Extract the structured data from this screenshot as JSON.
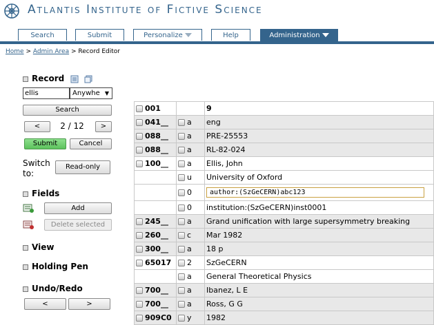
{
  "header": {
    "site_title": "Atlantis Institute of Fictive Science",
    "tabs": [
      {
        "label": "Search"
      },
      {
        "label": "Submit"
      },
      {
        "label": "Personalize"
      },
      {
        "label": "Help"
      },
      {
        "label": "Administration"
      }
    ]
  },
  "breadcrumb": {
    "home": "Home",
    "sep1": " > ",
    "admin": "Admin Area",
    "sep2": " > ",
    "current": "Record Editor"
  },
  "sidebar": {
    "record_title": "Record",
    "search_value": "ellis",
    "search_scope": "Anywhe",
    "search_button": "Search",
    "prev_label": "<",
    "next_label": ">",
    "position": "2 / 12",
    "submit_label": "Submit",
    "cancel_label": "Cancel",
    "switch_label": "Switch to:",
    "readonly_label": "Read-only",
    "fields_title": "Fields",
    "add_label": "Add",
    "delete_label": "Delete selected",
    "view_title": "View",
    "holding_pen_title": "Holding Pen",
    "undo_title": "Undo/Redo",
    "undo_label": "<",
    "redo_label": ">"
  },
  "record": {
    "rows": [
      {
        "tag": "001",
        "ind": "",
        "value": "9"
      },
      {
        "tag": "041__",
        "ind": "a",
        "value": "eng"
      },
      {
        "tag": "088__",
        "ind": "a",
        "value": "PRE-25553"
      },
      {
        "tag": "088__",
        "ind": "a",
        "value": "RL-82-024"
      },
      {
        "tag": "100__",
        "ind": "a",
        "value": "Ellis, John"
      },
      {
        "tag": "",
        "ind": "u",
        "value": "University of Oxford"
      },
      {
        "tag": "",
        "ind": "0",
        "value": "author:(SzGeCERN)abc123",
        "editing": true
      },
      {
        "tag": "",
        "ind": "0",
        "value": "institution:(SzGeCERN)inst0001"
      },
      {
        "tag": "245__",
        "ind": "a",
        "value": "Grand unification with large supersymmetry breaking"
      },
      {
        "tag": "260__",
        "ind": "c",
        "value": "Mar 1982"
      },
      {
        "tag": "300__",
        "ind": "a",
        "value": "18 p"
      },
      {
        "tag": "65017",
        "ind": "2",
        "value": "SzGeCERN"
      },
      {
        "tag": "",
        "ind": "a",
        "value": "General Theoretical Physics"
      },
      {
        "tag": "700__",
        "ind": "a",
        "value": "Ibanez, L E"
      },
      {
        "tag": "700__",
        "ind": "a",
        "value": "Ross, G G"
      },
      {
        "tag": "909C0",
        "ind": "y",
        "value": "1982"
      }
    ]
  },
  "colors": {
    "brand": "#34648c",
    "submit_green": "#5cc25c"
  }
}
